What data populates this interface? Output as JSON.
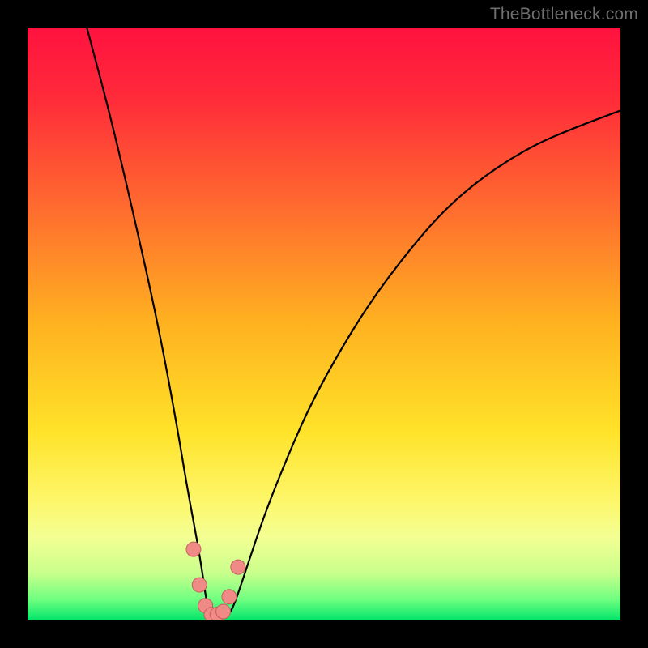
{
  "watermark": "TheBottleneck.com",
  "colors": {
    "gradient_stops": [
      {
        "offset": 0.0,
        "color": "#ff123f"
      },
      {
        "offset": 0.12,
        "color": "#ff2b3a"
      },
      {
        "offset": 0.3,
        "color": "#ff6a2f"
      },
      {
        "offset": 0.5,
        "color": "#ffb220"
      },
      {
        "offset": 0.68,
        "color": "#ffe229"
      },
      {
        "offset": 0.8,
        "color": "#fdf76b"
      },
      {
        "offset": 0.86,
        "color": "#f3ff93"
      },
      {
        "offset": 0.92,
        "color": "#c9ff8c"
      },
      {
        "offset": 0.965,
        "color": "#6eff80"
      },
      {
        "offset": 1.0,
        "color": "#00e56a"
      }
    ],
    "curve": "#000000",
    "marker_fill": "#f08a86",
    "marker_stroke": "#c3605c",
    "background": "#000000"
  },
  "chart_data": {
    "type": "line",
    "title": "",
    "xlabel": "",
    "ylabel": "",
    "xlim": [
      0,
      100
    ],
    "ylim": [
      0,
      100
    ],
    "grid": false,
    "legend": false,
    "series": [
      {
        "name": "bottleneck-curve",
        "x": [
          10,
          14,
          18,
          22,
          25,
          27,
          28.5,
          29.5,
          30.2,
          31,
          32,
          33,
          34,
          35,
          37,
          40,
          44,
          48,
          53,
          58,
          64,
          70,
          77,
          85,
          92,
          100
        ],
        "y": [
          100,
          85,
          68,
          50,
          34,
          22,
          14,
          8,
          3,
          1,
          0.5,
          0.5,
          1,
          3,
          9,
          18,
          28,
          37,
          46,
          54,
          62,
          69,
          75,
          80,
          83,
          86
        ]
      }
    ],
    "markers": {
      "name": "bottleneck-markers",
      "x": [
        28.0,
        29.0,
        30.0,
        31.0,
        32.0,
        33.0,
        34.0,
        35.5
      ],
      "y": [
        12.0,
        6.0,
        2.5,
        1.0,
        1.0,
        1.5,
        4.0,
        9.0
      ]
    }
  }
}
